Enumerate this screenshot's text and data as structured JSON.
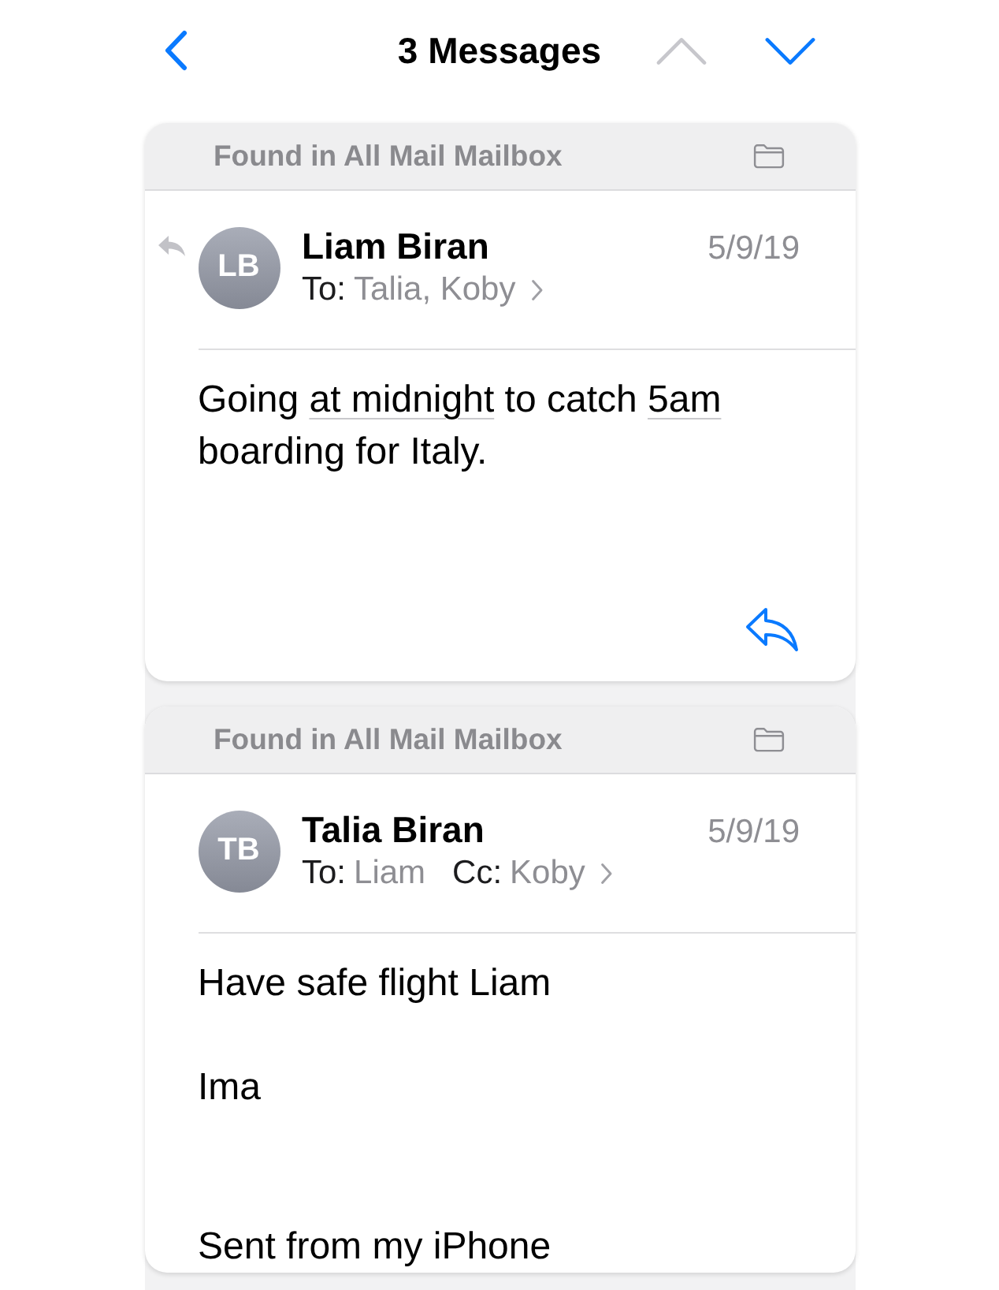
{
  "nav": {
    "title": "3 Messages",
    "arrows": [
      {
        "kind": "up",
        "disabled": true
      },
      {
        "kind": "down",
        "disabled": false
      }
    ]
  },
  "messages": [
    {
      "found_in": "Found in All Mail Mailbox",
      "replied": true,
      "initials": "LB",
      "sender": "Liam Biran",
      "date": "5/9/19",
      "recipients": [
        {
          "label": "To:",
          "names": "Talia, Koby"
        }
      ],
      "body": [
        {
          "kind": "text",
          "segments": [
            {
              "kind": "plain",
              "text": "Going "
            },
            {
              "kind": "link",
              "text": "at midnight"
            },
            {
              "kind": "plain",
              "text": " to catch "
            },
            {
              "kind": "link",
              "text": "5am"
            },
            {
              "kind": "plain",
              "text": " boarding for Italy."
            }
          ]
        }
      ],
      "reply_button": true
    },
    {
      "found_in": "Found in All Mail Mailbox",
      "replied": false,
      "initials": "TB",
      "sender": "Talia Biran",
      "date": "5/9/19",
      "recipients": [
        {
          "label": "To:",
          "names": "Liam"
        },
        {
          "label": "Cc:",
          "names": "Koby"
        }
      ],
      "body": [
        {
          "kind": "text",
          "segments": [
            {
              "kind": "plain",
              "text": "Have safe flight Liam"
            }
          ]
        },
        {
          "kind": "text",
          "segments": [
            {
              "kind": "plain",
              "text": "Ima"
            }
          ]
        },
        {
          "kind": "signature",
          "segments": [
            {
              "kind": "plain",
              "text": "Sent from my iPhone"
            }
          ]
        }
      ],
      "reply_button": false
    }
  ]
}
